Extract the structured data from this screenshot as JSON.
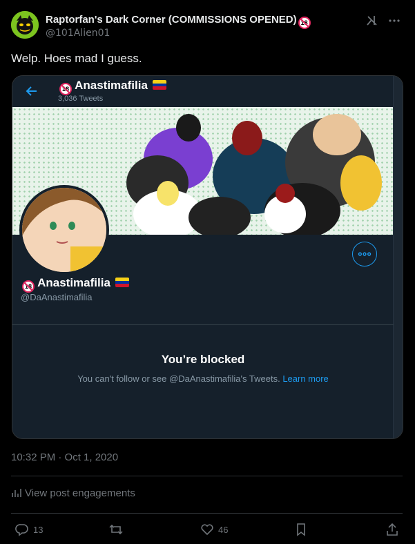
{
  "post": {
    "author_name": "Raptorfan's Dark Corner (COMMISSIONS OPENED)",
    "author_badge": "18",
    "author_handle": "@101Alien01",
    "text": "Welp. Hoes mad I guess.",
    "timestamp": "10:32 PM · Oct 1, 2020",
    "engagements_label": "View post engagements"
  },
  "embed": {
    "profile_name": "Anastimafilia",
    "badge": "18",
    "tweet_count": "3,036 Tweets",
    "handle": "@DaAnastimafilia",
    "blocked_title": "You’re blocked",
    "blocked_text": "You can't follow or see @DaAnastimafilia's Tweets.",
    "learn_more": "Learn more"
  },
  "actions": {
    "replies": "13",
    "likes": "46"
  },
  "colors": {
    "accent": "#1d9bf0",
    "background": "#000000",
    "embed_background": "#15202b",
    "muted": "#71767b"
  },
  "icons": [
    "grok-icon",
    "more-icon",
    "back-icon",
    "more-circle-icon",
    "stats-icon",
    "reply-icon",
    "retweet-icon",
    "like-icon",
    "bookmark-icon",
    "share-icon"
  ]
}
